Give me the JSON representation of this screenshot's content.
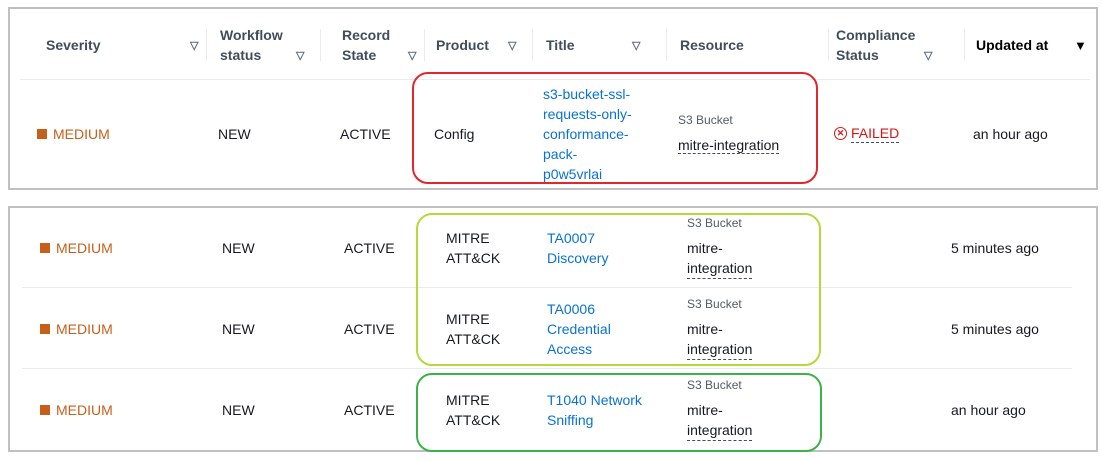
{
  "headers": {
    "severity": "Severity",
    "workflow_1": "Workflow",
    "workflow_2": "status",
    "record_1": "Record",
    "record_2": "State",
    "product": "Product",
    "title": "Title",
    "resource": "Resource",
    "compliance_1": "Compliance",
    "compliance_2": "Status",
    "updated": "Updated at"
  },
  "top_row": {
    "severity": "MEDIUM",
    "workflow": "NEW",
    "record": "ACTIVE",
    "product": "Config",
    "title_lines": [
      "s3-bucket-ssl-",
      "requests-only-",
      "conformance-",
      "pack-",
      "p0w5vrlai"
    ],
    "resource_type": "S3 Bucket",
    "resource_name": "mitre-integration",
    "compliance": "FAILED",
    "updated": "an hour ago"
  },
  "bottom_rows": [
    {
      "severity": "MEDIUM",
      "workflow": "NEW",
      "record": "ACTIVE",
      "product_lines": [
        "MITRE",
        "ATT&CK"
      ],
      "title_lines": [
        "TA0007",
        "Discovery"
      ],
      "resource_type": "S3 Bucket",
      "resource_lines": [
        "mitre-",
        "integration"
      ],
      "updated": "5 minutes ago"
    },
    {
      "severity": "MEDIUM",
      "workflow": "NEW",
      "record": "ACTIVE",
      "product_lines": [
        "MITRE",
        "ATT&CK"
      ],
      "title_lines": [
        "TA0006",
        "Credential",
        "Access"
      ],
      "resource_type": "S3 Bucket",
      "resource_lines": [
        "mitre-",
        "integration"
      ],
      "updated": "5 minutes ago"
    },
    {
      "severity": "MEDIUM",
      "workflow": "NEW",
      "record": "ACTIVE",
      "product_lines": [
        "MITRE",
        "ATT&CK"
      ],
      "title_lines": [
        "T1040 Network",
        "Sniffing"
      ],
      "resource_type": "S3 Bucket",
      "resource_lines": [
        "mitre-",
        "integration"
      ],
      "updated": "an hour ago"
    }
  ],
  "colors": {
    "severity_medium": "#c65f1a",
    "link": "#0972d3",
    "failed": "#d91515",
    "highlight_red": "#e3262b",
    "highlight_lime": "#b5d93a",
    "highlight_green": "#3db24a"
  },
  "icons": {
    "sort": "triangle-down-outline",
    "sort_active": "triangle-down-filled",
    "severity": "square",
    "failed": "x-circle"
  }
}
